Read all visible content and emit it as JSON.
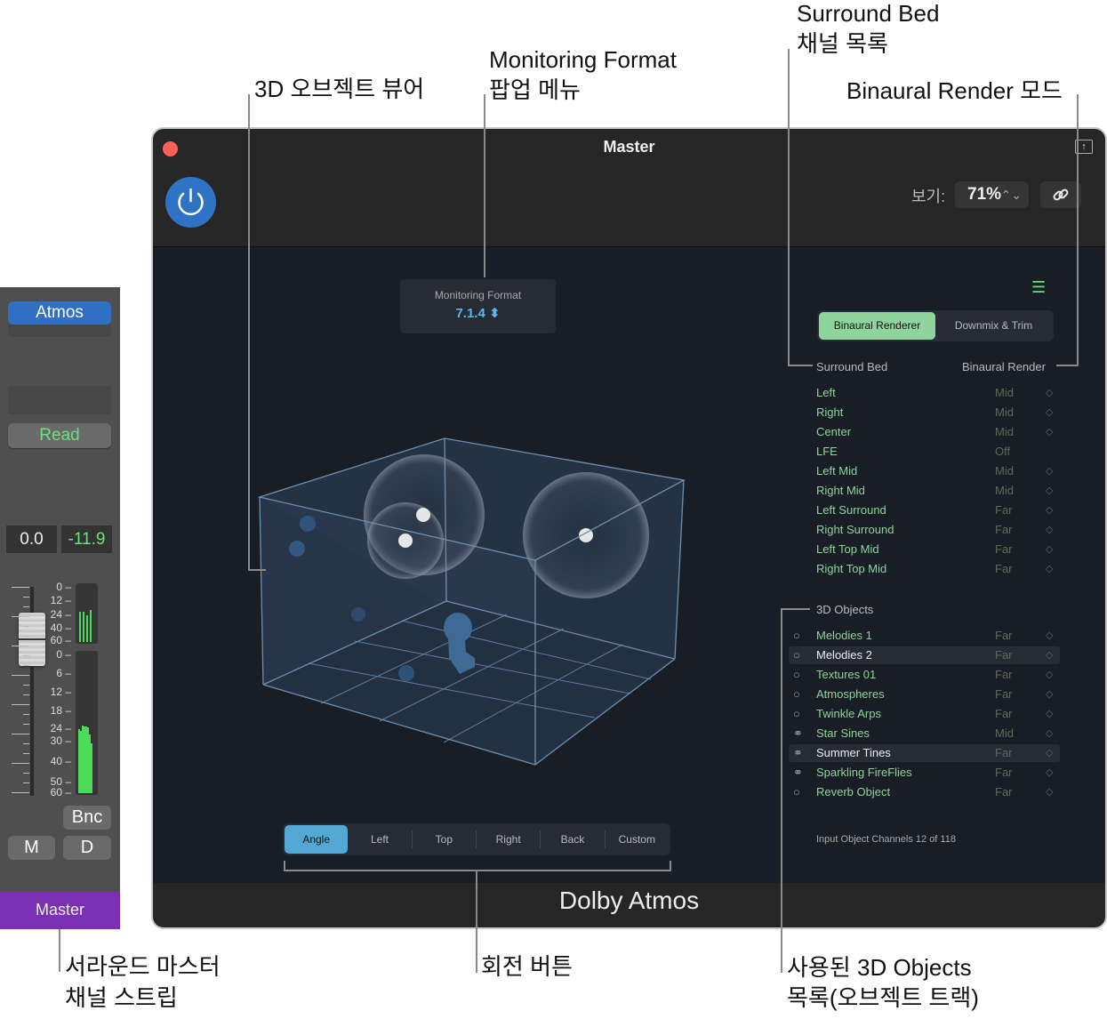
{
  "callouts": {
    "viewer": "3D 오브젝트 뷰어",
    "monitoring_line1": "Monitoring Format",
    "monitoring_line2": "팝업 메뉴",
    "surround_line1": "Surround Bed",
    "surround_line2": "채널 목록",
    "binaural_mode": "Binaural Render 모드",
    "strip_line1": "서라운드 마스터",
    "strip_line2": "채널 스트립",
    "rotation": "회전 버튼",
    "objects_line1": "사용된 3D Objects",
    "objects_line2": "목록(오브젝트 트랙)"
  },
  "channel_strip": {
    "output_button": "Atmos",
    "automation_mode": "Read",
    "volume": "0.0",
    "peak": "-11.9",
    "meter_scale_top": [
      "0",
      "12",
      "24",
      "40",
      "60"
    ],
    "meter_scale_bottom": [
      "0",
      "6",
      "12",
      "18",
      "24",
      "30",
      "40",
      "50",
      "60"
    ],
    "bounce_button": "Bnc",
    "mute_button": "M",
    "dim_button": "D",
    "name": "Master",
    "name_color": "#7b2fb5"
  },
  "window": {
    "title": "Master",
    "view_label": "보기:",
    "view_zoom": "71%",
    "footer": "Dolby Atmos"
  },
  "monitoring_format": {
    "label": "Monitoring Format",
    "value": "7.1.4"
  },
  "view_buttons": [
    {
      "label": "Angle",
      "active": true
    },
    {
      "label": "Left"
    },
    {
      "label": "Top"
    },
    {
      "label": "Right"
    },
    {
      "label": "Back"
    },
    {
      "label": "Custom"
    }
  ],
  "mode_tabs": {
    "binaural": "Binaural Renderer",
    "downmix": "Downmix & Trim"
  },
  "surround_bed": {
    "header": "Surround Bed",
    "render_header": "Binaural Render",
    "channels": [
      {
        "name": "Left",
        "mode": "Mid"
      },
      {
        "name": "Right",
        "mode": "Mid"
      },
      {
        "name": "Center",
        "mode": "Mid"
      },
      {
        "name": "LFE",
        "mode": "Off"
      },
      {
        "name": "Left Mid",
        "mode": "Mid"
      },
      {
        "name": "Right Mid",
        "mode": "Mid"
      },
      {
        "name": "Left Surround",
        "mode": "Far"
      },
      {
        "name": "Right Surround",
        "mode": "Far"
      },
      {
        "name": "Left Top Mid",
        "mode": "Far"
      },
      {
        "name": "Right Top Mid",
        "mode": "Far"
      }
    ]
  },
  "objects": {
    "header": "3D Objects",
    "items": [
      {
        "name": "Melodies 1",
        "mode": "Far",
        "type": "mono"
      },
      {
        "name": "Melodies 2",
        "mode": "Far",
        "type": "mono",
        "selected": true
      },
      {
        "name": "Textures 01",
        "mode": "Far",
        "type": "mono"
      },
      {
        "name": "Atmospheres",
        "mode": "Far",
        "type": "mono"
      },
      {
        "name": "Twinkle Arps",
        "mode": "Far",
        "type": "mono"
      },
      {
        "name": "Star Sines",
        "mode": "Mid",
        "type": "stereo"
      },
      {
        "name": "Summer Tines",
        "mode": "Far",
        "type": "stereo",
        "selected": true
      },
      {
        "name": "Sparkling FireFlies",
        "mode": "Far",
        "type": "stereo"
      },
      {
        "name": "Reverb Object",
        "mode": "Far",
        "type": "mono"
      }
    ],
    "count_text": "Input Object Channels 12 of 118"
  }
}
